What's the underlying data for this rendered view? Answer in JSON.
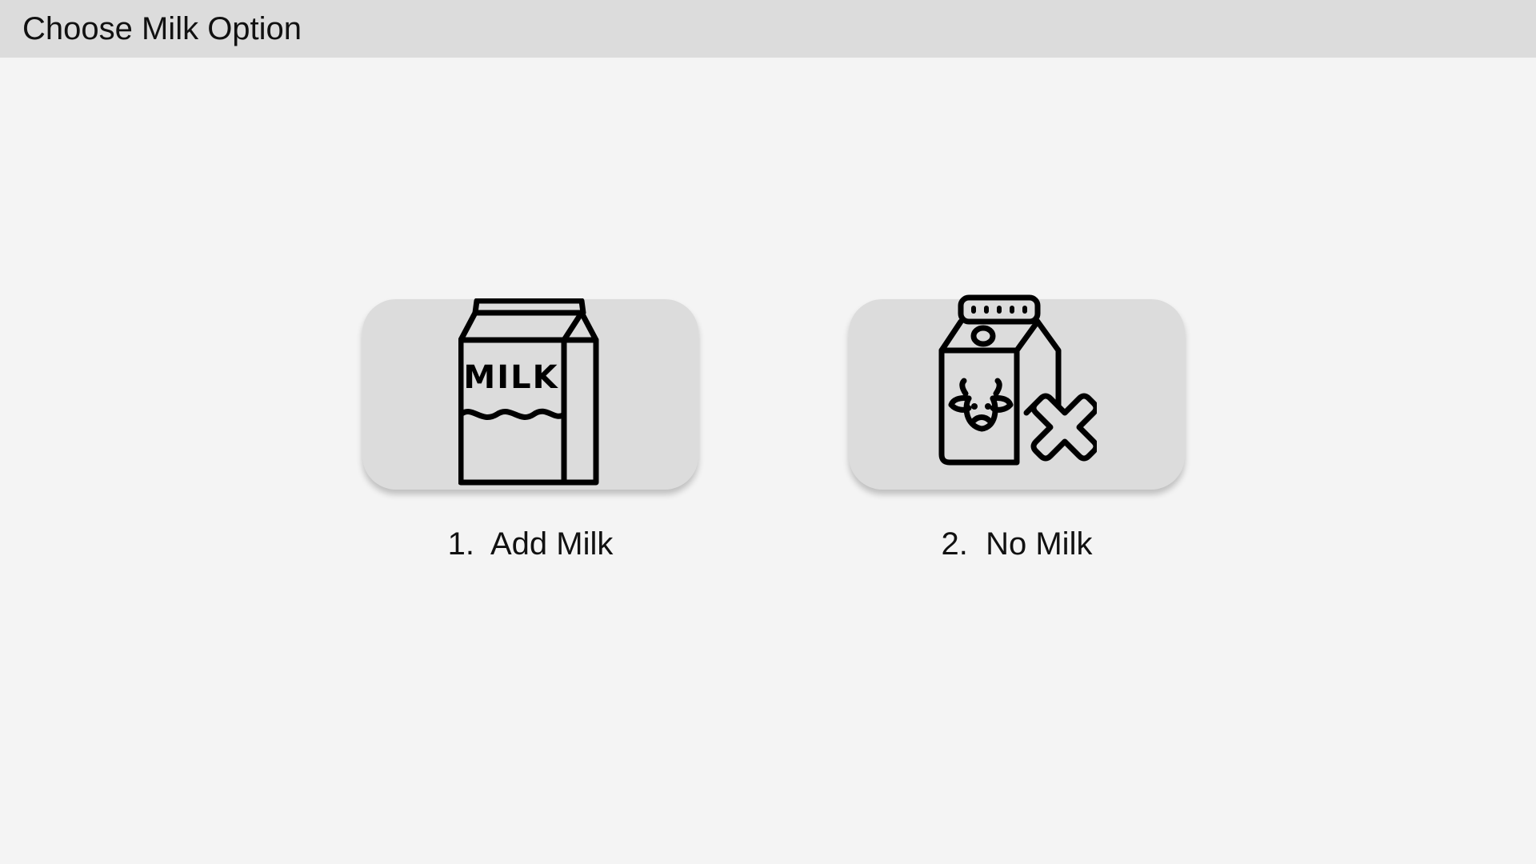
{
  "header": {
    "title": "Choose Milk Option"
  },
  "options": [
    {
      "label": "1.  Add Milk",
      "icon": "milk-carton-icon",
      "icon_text": "MILK"
    },
    {
      "label": "2.  No Milk",
      "icon": "no-milk-icon"
    }
  ],
  "colors": {
    "header_bg": "#dcdcdc",
    "page_bg": "#f4f4f4",
    "card_bg": "#dcdcdc",
    "icon_stroke": "#000000"
  }
}
